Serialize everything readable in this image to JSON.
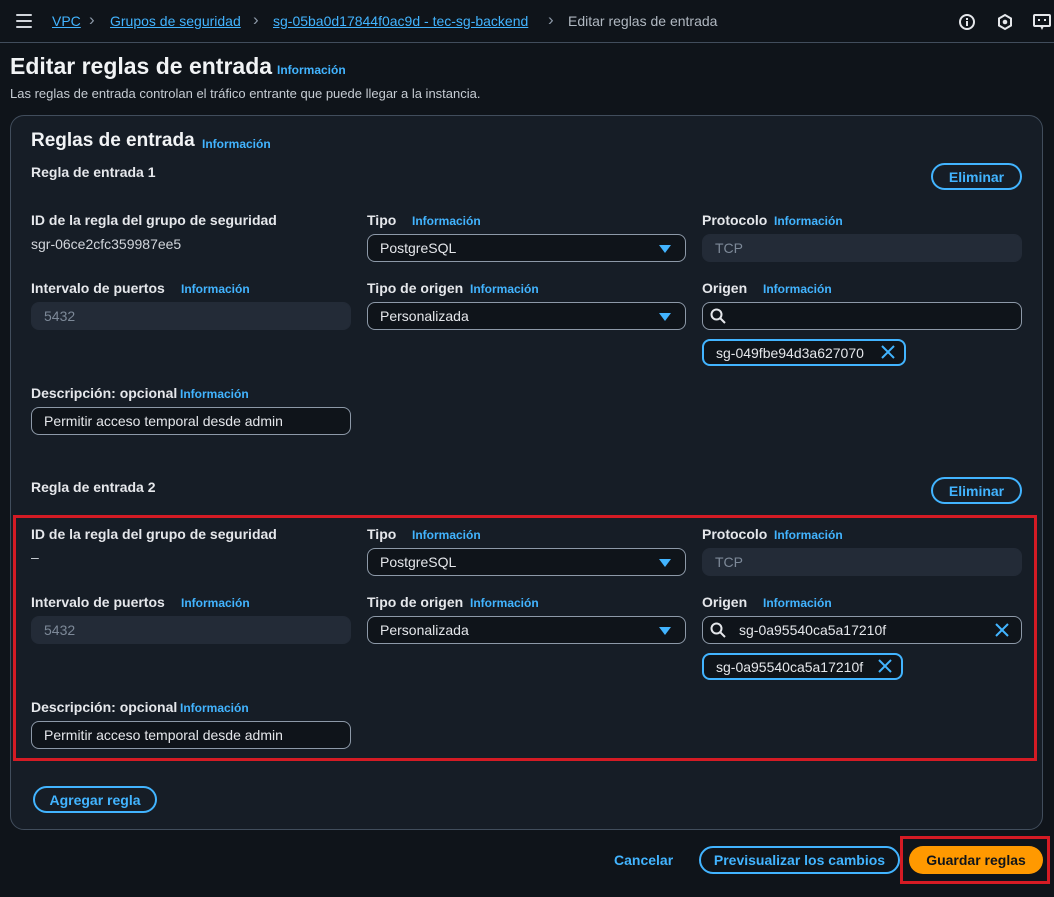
{
  "breadcrumb": {
    "items": [
      "VPC",
      "Grupos de seguridad",
      "sg-05ba0d17844f0ac9d - tec-sg-backend"
    ],
    "current": "Editar reglas de entrada"
  },
  "page": {
    "title": "Editar reglas de entrada",
    "info": "Información",
    "description": "Las reglas de entrada controlan el tráfico entrante que puede llegar a la instancia."
  },
  "section": {
    "title": "Reglas de entrada",
    "info": "Información"
  },
  "labels": {
    "rule_id": "ID de la regla del grupo de seguridad",
    "type": "Tipo",
    "protocol": "Protocolo",
    "port_range": "Intervalo de puertos",
    "source_type": "Tipo de origen",
    "source": "Origen",
    "description": "Descripción: opcional",
    "info": "Información",
    "delete": "Eliminar"
  },
  "rules": [
    {
      "heading": "Regla de entrada 1",
      "rule_id": "sgr-06ce2cfc359987ee5",
      "type": "PostgreSQL",
      "protocol": "TCP",
      "port_range": "5432",
      "source_type": "Personalizada",
      "source_search": "",
      "source_token": "sg-049fbe94d3a627070",
      "description": "Permitir acceso temporal desde admin"
    },
    {
      "heading": "Regla de entrada 2",
      "rule_id": "–",
      "type": "PostgreSQL",
      "protocol": "TCP",
      "port_range": "5432",
      "source_type": "Personalizada",
      "source_search": "sg-0a95540ca5a17210f",
      "source_token": "sg-0a95540ca5a17210f",
      "description": "Permitir acceso temporal desde admin"
    }
  ],
  "actions": {
    "add_rule": "Agregar regla",
    "cancel": "Cancelar",
    "preview": "Previsualizar los cambios",
    "save": "Guardar reglas"
  },
  "colors": {
    "accent": "#42b4ff",
    "primary": "#ff9900",
    "highlight": "#d41b24",
    "background": "#0f141a"
  }
}
